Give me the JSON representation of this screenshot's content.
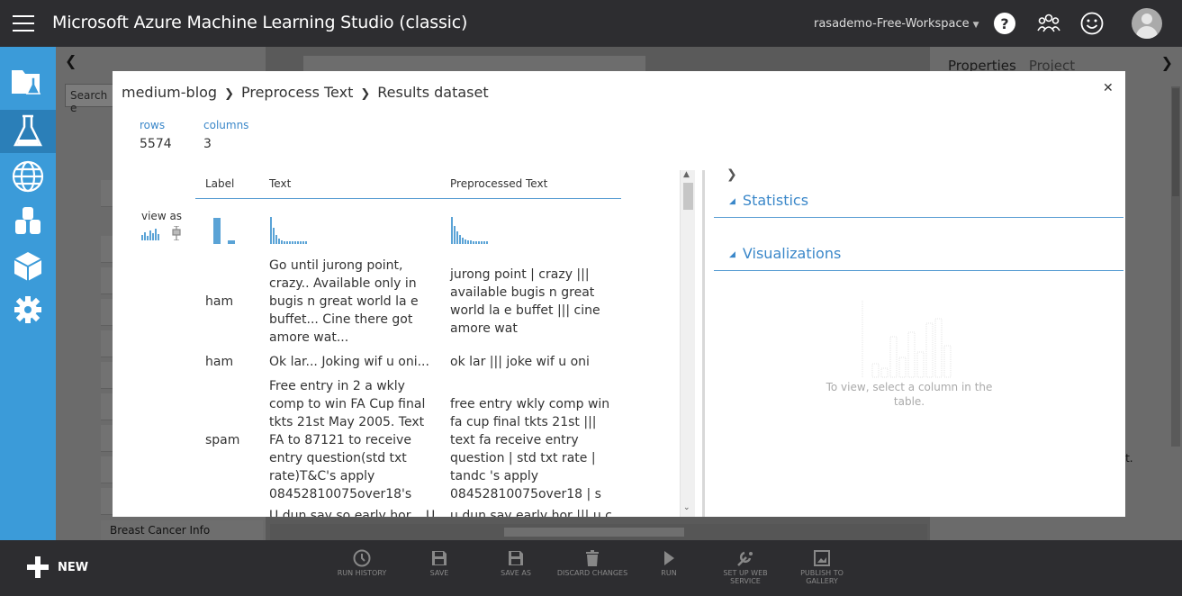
{
  "app": {
    "title": "Microsoft Azure Machine Learning Studio (classic)",
    "workspace": "rasademo-Free-Workspace"
  },
  "background": {
    "search_placeholder": "Search e",
    "list_item_bottom": "Breast Cancer Info",
    "right_tabs": [
      "Properties",
      "Project"
    ],
    "right_text_fragment": "xt."
  },
  "modal": {
    "breadcrumb": [
      "medium-blog",
      "Preprocess Text",
      "Results dataset"
    ],
    "stats": {
      "rows_label": "rows",
      "rows_value": "5574",
      "columns_label": "columns",
      "columns_value": "3"
    },
    "view_as_label": "view as",
    "columns": [
      "Label",
      "Text",
      "Preprocessed Text"
    ],
    "rows": [
      {
        "label": "ham",
        "text": "Go until jurong point, crazy.. Available only in bugis n great world la e buffet... Cine there got amore wat...",
        "pre": "jurong point | crazy ||| available bugis n great world la e buffet ||| cine amore wat"
      },
      {
        "label": "ham",
        "text": "Ok lar... Joking wif u oni...",
        "pre": "ok lar ||| joke wif u oni"
      },
      {
        "label": "spam",
        "text": "Free entry in 2 a wkly comp to win FA Cup final tkts 21st May 2005. Text FA to 87121 to receive entry question(std txt rate)T&C's apply 08452810075over18's",
        "pre": "free entry wkly comp win fa cup final tkts 21st ||| text fa receive entry question | std txt rate | tandc 's apply 08452810075over18 | s"
      },
      {
        "label": "",
        "text": "U dun say so early hor... U",
        "pre": "u dun say early hor ||| u c"
      }
    ],
    "panel": {
      "statistics": "Statistics",
      "visualizations": "Visualizations",
      "viz_note": "To view, select a column in the table."
    }
  },
  "bottom": {
    "new_label": "NEW",
    "commands": [
      "RUN HISTORY",
      "SAVE",
      "SAVE AS",
      "DISCARD CHANGES",
      "RUN",
      "SET UP WEB SERVICE",
      "PUBLISH TO GALLERY"
    ]
  },
  "colors": {
    "accent": "#3a87c9",
    "nav_blue": "#3b9bd9",
    "topbar": "#2d2d30",
    "hist_bar": "#5aa3d6"
  }
}
